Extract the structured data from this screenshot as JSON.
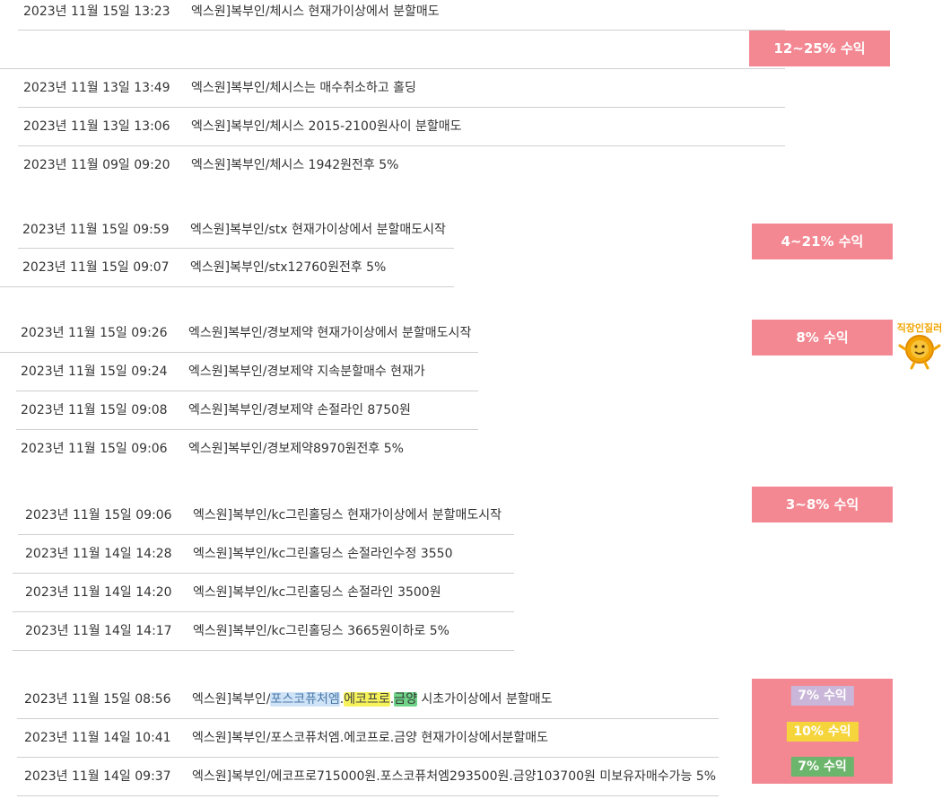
{
  "groups": [
    {
      "rows": [
        {
          "date": "2023년 11월 15일 13:23",
          "title": "엑스원]복부인/체시스 현재가이상에서 분할매도"
        },
        {
          "date": "",
          "title": ""
        },
        {
          "date": "2023년 11월 13일 13:49",
          "title": "엑스원]복부인/체시스는 매수취소하고 홀딩"
        },
        {
          "date": "2023년 11월 13일 13:06",
          "title": "엑스원]복부인/체시스 2015-2100원사이 분할매도"
        },
        {
          "date": "2023년 11월 09일 09:20",
          "title": "엑스원]복부인/체시스 1942원전후 5%"
        }
      ],
      "badge": "12~25% 수익"
    },
    {
      "rows": [
        {
          "date": "2023년 11월 15일 09:59",
          "title": "엑스원]복부인/stx 현재가이상에서 분할매도시작"
        },
        {
          "date": "2023년 11월 15일 09:07",
          "title": "엑스원]복부인/stx12760원전후 5%"
        }
      ],
      "badge": "4~21% 수익"
    },
    {
      "rows": [
        {
          "date": "2023년 11월 15일 09:26",
          "title": "엑스원]복부인/경보제약 현재가이상에서 분할매도시작"
        },
        {
          "date": "2023년 11월 15일 09:24",
          "title": "엑스원]복부인/경보제약 지속분할매수 현재가"
        },
        {
          "date": "2023년 11월 15일 09:08",
          "title": "엑스원]복부인/경보제약 손절라인 8750원"
        },
        {
          "date": "2023년 11월 15일 09:06",
          "title": "엑스원]복부인/경보제약8970원전후 5%"
        }
      ],
      "badge": "8% 수익",
      "sticker_text": "직장인질러"
    },
    {
      "rows": [
        {
          "date": "2023년 11월 15일 09:06",
          "title": "엑스원]복부인/kc그린홀딩스 현재가이상에서 분할매도시작"
        },
        {
          "date": "2023년 11월 14일 14:28",
          "title": "엑스원]복부인/kc그린홀딩스 손절라인수정 3550"
        },
        {
          "date": "2023년 11월 14일 14:20",
          "title": "엑스원]복부인/kc그린홀딩스 손절라인 3500원"
        },
        {
          "date": "2023년 11월 14일 14:17",
          "title": "엑스원]복부인/kc그린홀딩스 3665원이하로 5%"
        }
      ],
      "badge": "3~8% 수익"
    },
    {
      "rows": [
        {
          "date": "2023년 11월 15일 08:56",
          "title_parts": {
            "prefix": "엑스원]복부인/",
            "posco": "포스코퓨처엠",
            "dot1": ".",
            "eco": "에코프로",
            "dot2": ".",
            "geum": "금양",
            "suffix": " 시초가이상에서 분할매도"
          }
        },
        {
          "date": "2023년 11월 14일 10:41",
          "title": "엑스원]복부인/포스코퓨처엠.에코프로.금양 현재가이상에서분할매도"
        },
        {
          "date": "2023년 11월 14일 09:37",
          "title": "엑스원]복부인/에코프로715000원.포스코퓨처엠293500원.금양103700원 미보유자매수가능 5%"
        }
      ],
      "badges": [
        "7% 수익",
        "10% 수익",
        "7% 수익"
      ]
    }
  ],
  "colors": {
    "badge_bg": "#f38892",
    "row_border": "#cfcfcf",
    "text": "#333333",
    "highlight_blue": "#cfe3f7",
    "highlight_yellow": "#f6f35a",
    "highlight_green": "#6fd488",
    "pill_purple": "#c9b6d9",
    "pill_yellow": "#f5d43c",
    "pill_green": "#6cb56c",
    "sticker": "#f2a400"
  }
}
